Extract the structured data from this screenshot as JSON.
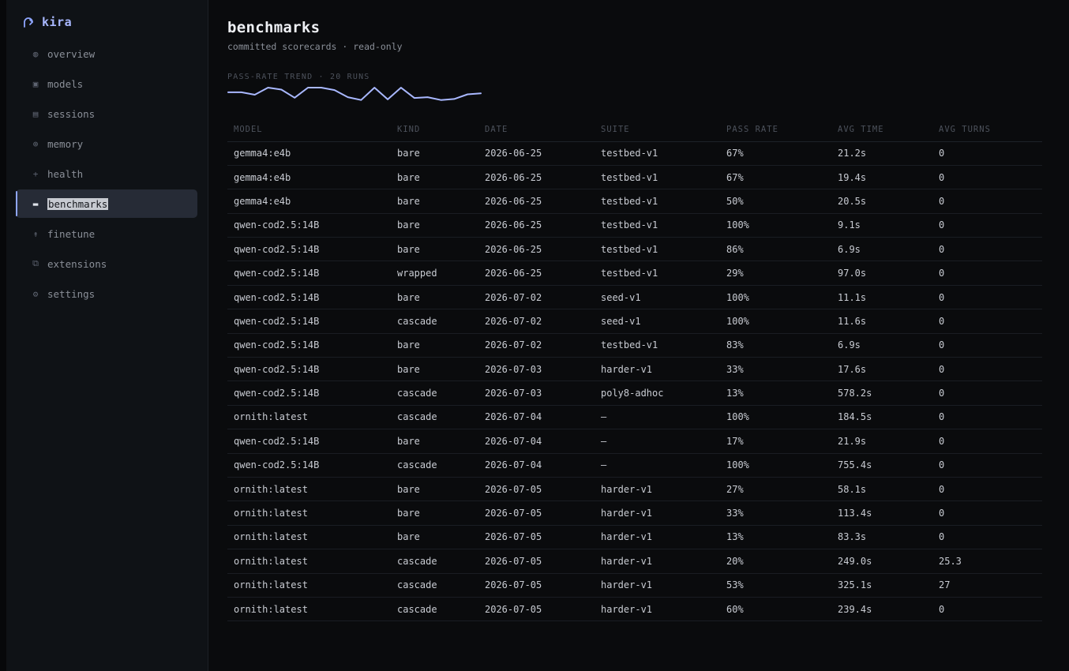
{
  "app": {
    "name": "kira"
  },
  "sidebar": {
    "items": [
      {
        "label": "overview",
        "icon": "globe-icon",
        "glyph": "◍",
        "active": false
      },
      {
        "label": "models",
        "icon": "cube-icon",
        "glyph": "▣",
        "active": false
      },
      {
        "label": "sessions",
        "icon": "list-icon",
        "glyph": "▤",
        "active": false
      },
      {
        "label": "memory",
        "icon": "circle-plus-icon",
        "glyph": "⊕",
        "active": false
      },
      {
        "label": "health",
        "icon": "plus-icon",
        "glyph": "+",
        "active": false
      },
      {
        "label": "benchmarks",
        "icon": "bar-icon",
        "glyph": "▬",
        "active": true
      },
      {
        "label": "finetune",
        "icon": "arrow-up-icon",
        "glyph": "↟",
        "active": false
      },
      {
        "label": "extensions",
        "icon": "copy-icon",
        "glyph": "⧉",
        "active": false
      },
      {
        "label": "settings",
        "icon": "gear-icon",
        "glyph": "⚙",
        "active": false
      }
    ]
  },
  "page": {
    "title": "benchmarks",
    "subtitle": "committed scorecards · read-only",
    "trend_label": "PASS-RATE TREND · 20 RUNS"
  },
  "trend": {
    "color": "#a9b8ff",
    "values": [
      67,
      67,
      50,
      100,
      86,
      29,
      100,
      100,
      83,
      33,
      13,
      100,
      17,
      100,
      27,
      33,
      13,
      20,
      53,
      60
    ]
  },
  "table": {
    "columns": [
      "MODEL",
      "KIND",
      "DATE",
      "SUITE",
      "PASS RATE",
      "AVG TIME",
      "AVG TURNS"
    ],
    "rows": [
      [
        "gemma4:e4b",
        "bare",
        "2026-06-25",
        "testbed-v1",
        "67%",
        "21.2s",
        "0"
      ],
      [
        "gemma4:e4b",
        "bare",
        "2026-06-25",
        "testbed-v1",
        "67%",
        "19.4s",
        "0"
      ],
      [
        "gemma4:e4b",
        "bare",
        "2026-06-25",
        "testbed-v1",
        "50%",
        "20.5s",
        "0"
      ],
      [
        "qwen-cod2.5:14B",
        "bare",
        "2026-06-25",
        "testbed-v1",
        "100%",
        "9.1s",
        "0"
      ],
      [
        "qwen-cod2.5:14B",
        "bare",
        "2026-06-25",
        "testbed-v1",
        "86%",
        "6.9s",
        "0"
      ],
      [
        "qwen-cod2.5:14B",
        "wrapped",
        "2026-06-25",
        "testbed-v1",
        "29%",
        "97.0s",
        "0"
      ],
      [
        "qwen-cod2.5:14B",
        "bare",
        "2026-07-02",
        "seed-v1",
        "100%",
        "11.1s",
        "0"
      ],
      [
        "qwen-cod2.5:14B",
        "cascade",
        "2026-07-02",
        "seed-v1",
        "100%",
        "11.6s",
        "0"
      ],
      [
        "qwen-cod2.5:14B",
        "bare",
        "2026-07-02",
        "testbed-v1",
        "83%",
        "6.9s",
        "0"
      ],
      [
        "qwen-cod2.5:14B",
        "bare",
        "2026-07-03",
        "harder-v1",
        "33%",
        "17.6s",
        "0"
      ],
      [
        "qwen-cod2.5:14B",
        "cascade",
        "2026-07-03",
        "poly8-adhoc",
        "13%",
        "578.2s",
        "0"
      ],
      [
        "ornith:latest",
        "cascade",
        "2026-07-04",
        "—",
        "100%",
        "184.5s",
        "0"
      ],
      [
        "qwen-cod2.5:14B",
        "bare",
        "2026-07-04",
        "—",
        "17%",
        "21.9s",
        "0"
      ],
      [
        "qwen-cod2.5:14B",
        "cascade",
        "2026-07-04",
        "—",
        "100%",
        "755.4s",
        "0"
      ],
      [
        "ornith:latest",
        "bare",
        "2026-07-05",
        "harder-v1",
        "27%",
        "58.1s",
        "0"
      ],
      [
        "ornith:latest",
        "bare",
        "2026-07-05",
        "harder-v1",
        "33%",
        "113.4s",
        "0"
      ],
      [
        "ornith:latest",
        "bare",
        "2026-07-05",
        "harder-v1",
        "13%",
        "83.3s",
        "0"
      ],
      [
        "ornith:latest",
        "cascade",
        "2026-07-05",
        "harder-v1",
        "20%",
        "249.0s",
        "25.3"
      ],
      [
        "ornith:latest",
        "cascade",
        "2026-07-05",
        "harder-v1",
        "53%",
        "325.1s",
        "27"
      ],
      [
        "ornith:latest",
        "cascade",
        "2026-07-05",
        "harder-v1",
        "60%",
        "239.4s",
        "0"
      ]
    ]
  }
}
